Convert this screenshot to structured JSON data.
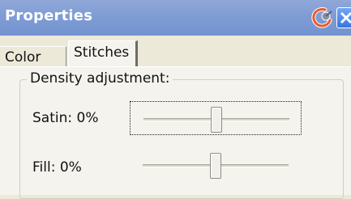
{
  "window": {
    "title": "Properties"
  },
  "tabs": [
    {
      "label": "Color",
      "selected": false
    },
    {
      "label": "Stitches",
      "selected": true
    }
  ],
  "density_group": {
    "title": "Density adjustment:",
    "satin": {
      "label": "Satin: 0%",
      "value": 0,
      "range": [
        -50,
        50
      ]
    },
    "fill": {
      "label": "Fill: 0%",
      "value": 0,
      "range": [
        -50,
        50
      ]
    }
  },
  "icons": {
    "pin": "pin-icon",
    "close": "close-icon"
  },
  "colors": {
    "titlebar": "#7f9cd4",
    "panel": "#f4f3ee",
    "close_button": "#3b75df"
  }
}
